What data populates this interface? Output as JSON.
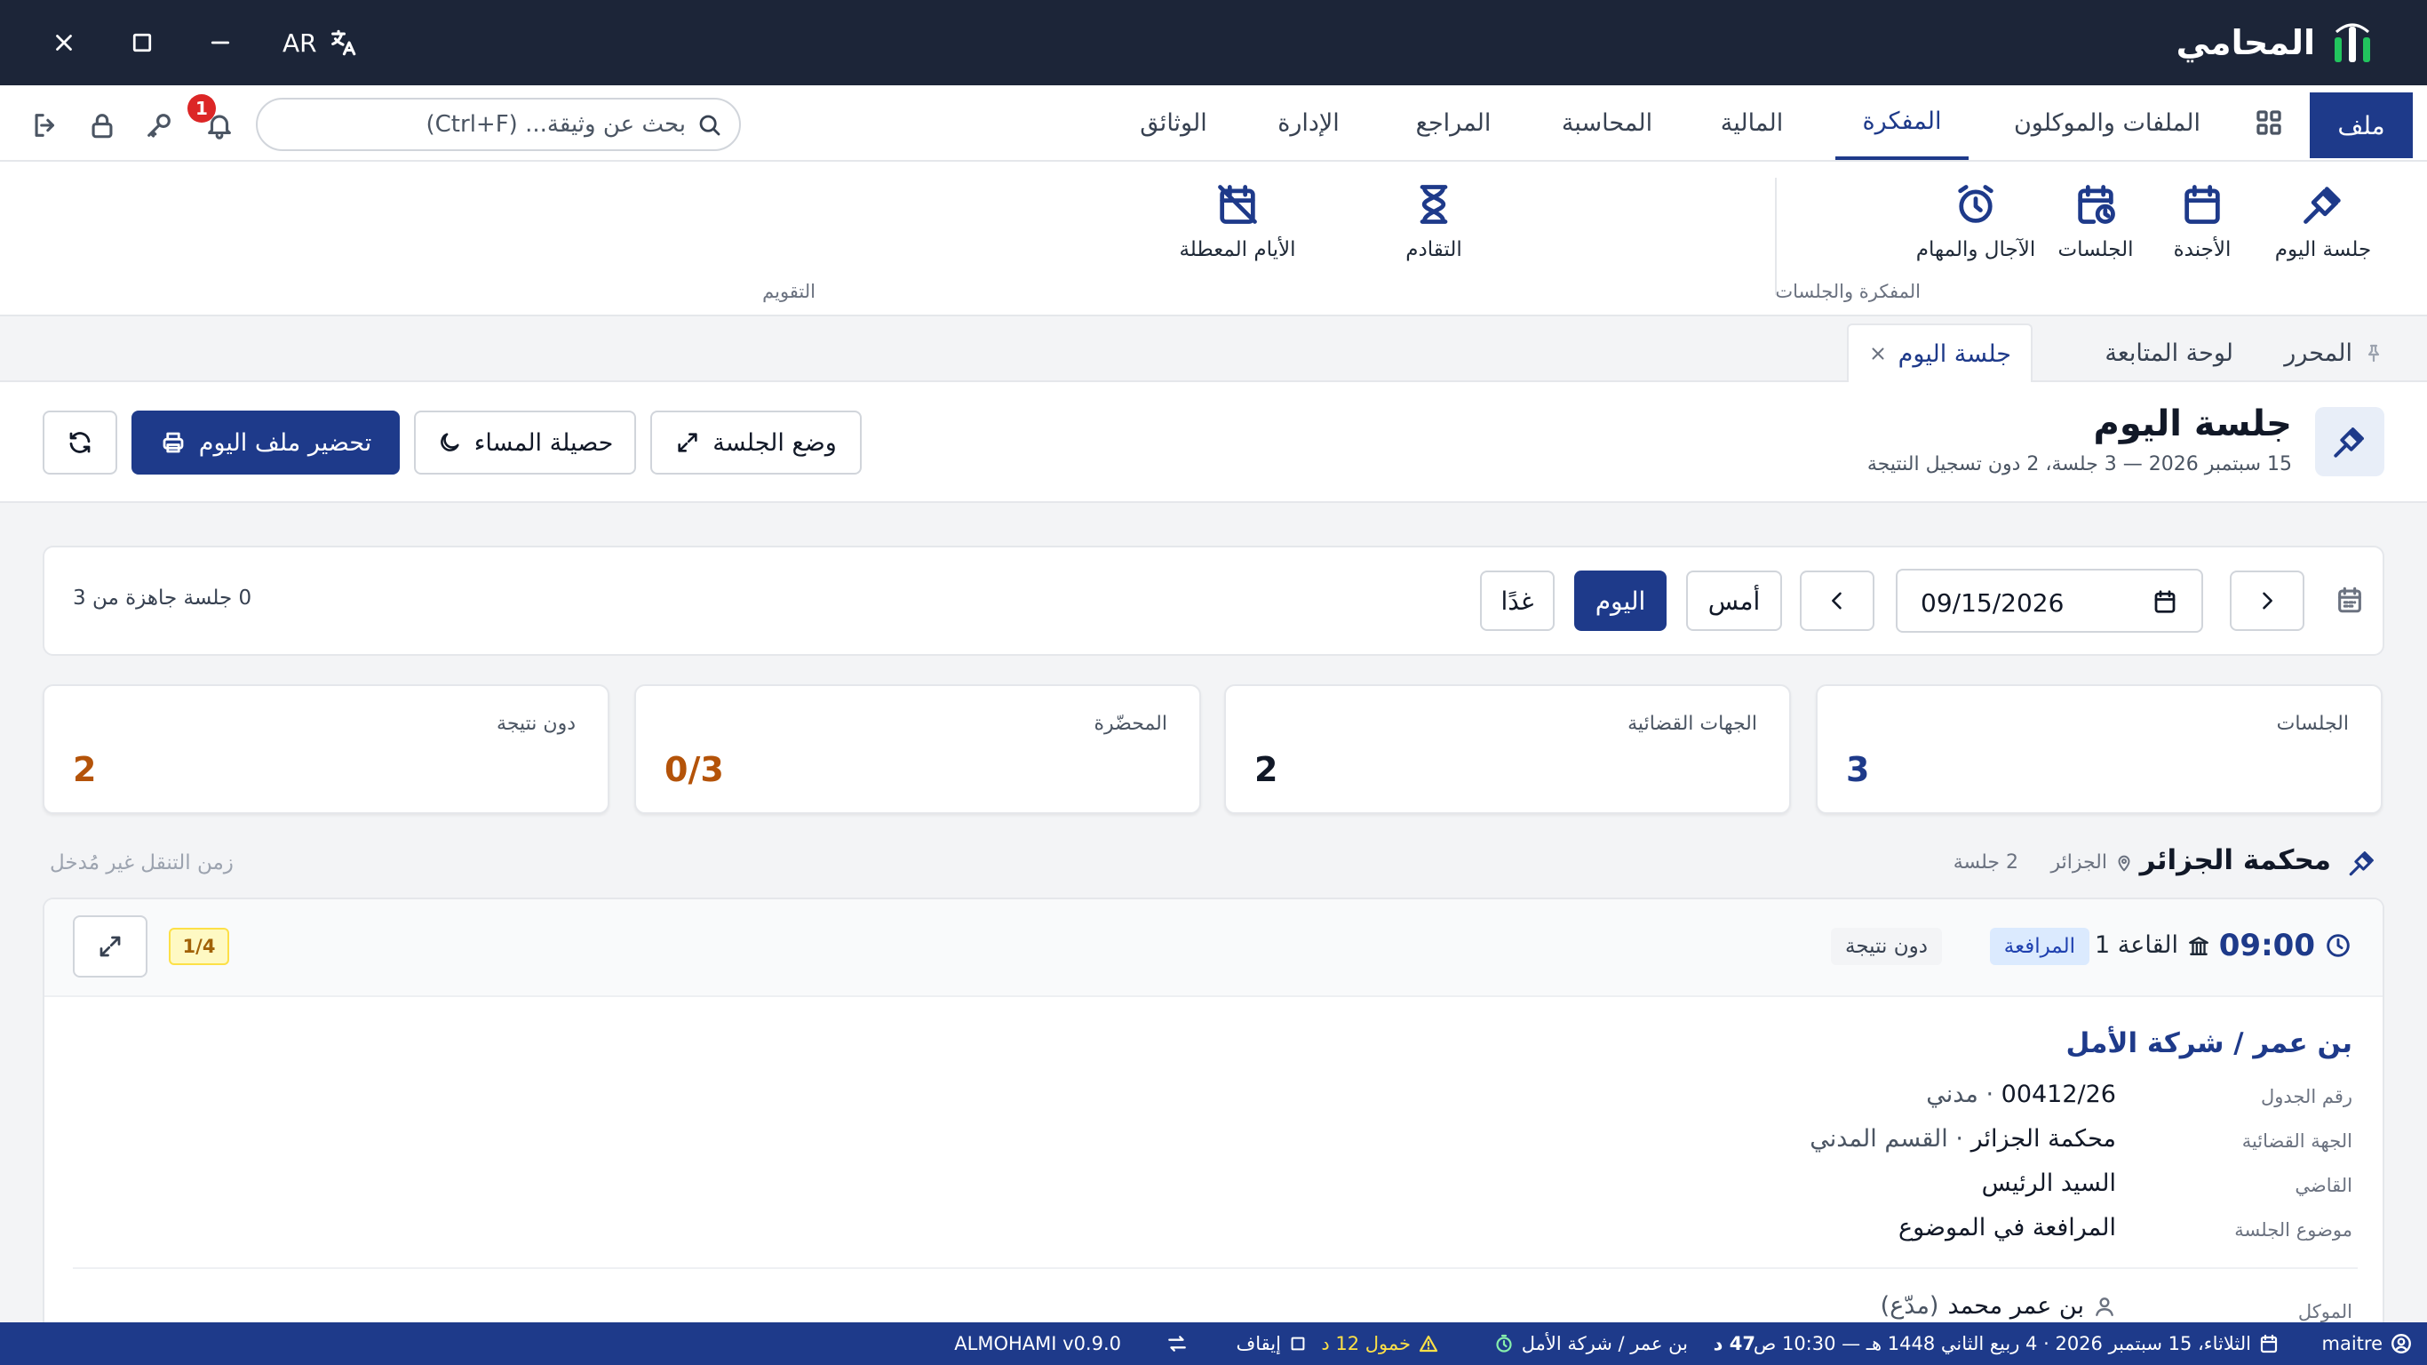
{
  "window": {
    "brand": "المحامي",
    "language": "AR"
  },
  "menu": {
    "file_label": "ملف",
    "tabs": [
      {
        "label": "الملفات والموكلون"
      },
      {
        "label": "المفكرة"
      },
      {
        "label": "المالية"
      },
      {
        "label": "المحاسبة"
      },
      {
        "label": "المراجع"
      },
      {
        "label": "الإدارة"
      },
      {
        "label": "الوثائق"
      }
    ],
    "search_placeholder": "بحث عن وثيقة... (Ctrl+F)",
    "notification_count": "1"
  },
  "ribbon": {
    "items": [
      {
        "label": "جلسة اليوم",
        "icon": "gavel-icon"
      },
      {
        "label": "الأجندة",
        "icon": "calendar-icon"
      },
      {
        "label": "الجلسات",
        "icon": "calendar-clock-icon"
      },
      {
        "label": "الآجال والمهام",
        "icon": "alarm-clock-icon"
      },
      {
        "label": "التقادم",
        "icon": "hourglass-icon"
      },
      {
        "label": "الأيام المعطلة",
        "icon": "calendar-off-icon"
      }
    ],
    "groups": [
      {
        "label": "المفكرة والجلسات"
      },
      {
        "label": "التقويم"
      }
    ]
  },
  "doc_tabs": [
    {
      "label": "المحرر"
    },
    {
      "label": "لوحة المتابعة"
    },
    {
      "label": "جلسة اليوم"
    }
  ],
  "page_header": {
    "title": "جلسة اليوم",
    "subtitle": "15 سبتمبر 2026 — 3 جلسة، 2 دون تسجيل النتيجة",
    "btn_session_mode": "وضع الجلسة",
    "btn_evening": "حصيلة المساء",
    "btn_prepare": "تحضير ملف اليوم"
  },
  "date_bar": {
    "date_value": "09/15/2026",
    "yesterday": "أمس",
    "today": "اليوم",
    "tomorrow": "غدًا",
    "ready_text": "0 جلسة جاهزة من 3"
  },
  "stats": [
    {
      "label": "الجلسات",
      "value": "3",
      "color": "#1e3a8a"
    },
    {
      "label": "الجهات القضائية",
      "value": "2",
      "color": "#111827"
    },
    {
      "label": "المحضّرة",
      "value": "0/3",
      "color": "#b45309"
    },
    {
      "label": "دون نتيجة",
      "value": "2",
      "color": "#b45309"
    }
  ],
  "court": {
    "name": "محكمة الجزائر",
    "city": "الجزائر",
    "count": "2 جلسة",
    "travel_note": "زمن التنقل غير مُدخل"
  },
  "session": {
    "time": "09:00",
    "hall": "القاعة 1",
    "type_badge": "المرافعة",
    "result_badge": "دون نتيجة",
    "progress": "1/4",
    "case_title": "بن عمر / شركة الأمل",
    "fields": [
      {
        "label": "رقم الجدول",
        "value": "00412/26",
        "extra": "مدني"
      },
      {
        "label": "الجهة القضائية",
        "value": "محكمة الجزائر",
        "extra": "القسم المدني"
      },
      {
        "label": "القاضي",
        "value": "السيد الرئيس",
        "extra": ""
      },
      {
        "label": "موضوع الجلسة",
        "value": "المرافعة في الموضوع",
        "extra": ""
      }
    ],
    "client_label": "الموكل",
    "client_name": "بن عمر محمد",
    "client_role": "(مدّع)"
  },
  "status_bar": {
    "user": "maitre",
    "date_text": "الثلاثاء، 15 سبتمبر 2026 · 4 ربيع الثاني 1448 هـ — 10:30 ص",
    "timer": "47 د",
    "timer_case": "بن عمر / شركة الأمل",
    "warning": "خمول 12 د",
    "pause": "إيقاف",
    "version": "ALMOHAMI v0.9.0"
  }
}
